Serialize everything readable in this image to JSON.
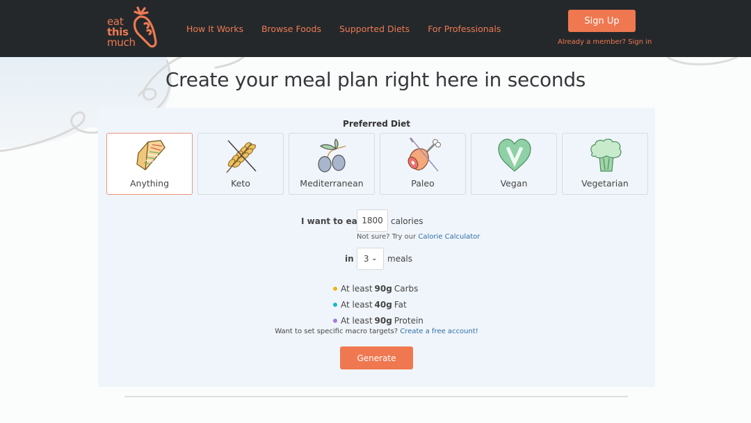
{
  "header": {
    "logo": {
      "line1": "eat",
      "line2": "this",
      "line3": "much"
    },
    "nav": [
      {
        "label": "How It Works"
      },
      {
        "label": "Browse Foods"
      },
      {
        "label": "Supported Diets"
      },
      {
        "label": "For Professionals"
      }
    ],
    "signup_label": "Sign Up",
    "signin_label": "Already a member? Sign in"
  },
  "main": {
    "title": "Create your meal plan right here in seconds",
    "preferred_diet_label": "Preferred Diet",
    "selected_diet": "Anything",
    "diets": [
      {
        "label": "Anything",
        "icon": "sandwich-icon"
      },
      {
        "label": "Keto",
        "icon": "crossed-wheat-icon"
      },
      {
        "label": "Mediterranean",
        "icon": "olives-icon"
      },
      {
        "label": "Paleo",
        "icon": "meat-leg-icon"
      },
      {
        "label": "Vegan",
        "icon": "vegan-heart-icon"
      },
      {
        "label": "Vegetarian",
        "icon": "broccoli-icon"
      }
    ],
    "calories": {
      "label": "I want to eat",
      "value": "1800",
      "unit": "calories",
      "help_text": "Not sure? Try our",
      "help_link": "Calorie Calculator"
    },
    "meals": {
      "label": "in",
      "value": "3",
      "unit": "meals"
    },
    "macros": [
      {
        "prefix": "At least",
        "amount": "90g",
        "name": "Carbs",
        "color": "#f0b41a"
      },
      {
        "prefix": "At least",
        "amount": "40g",
        "name": "Fat",
        "color": "#1fb7c4"
      },
      {
        "prefix": "At least",
        "amount": "90g",
        "name": "Protein",
        "color": "#a47be0"
      }
    ],
    "macro_note": "Want to set specific macro targets?",
    "macro_link": "Create a free account!",
    "generate_label": "Generate"
  },
  "colors": {
    "brand": "#ef7850",
    "header_bg": "#24282b",
    "panel_bg": "#f0f5fb",
    "link": "#2e6fa6"
  }
}
